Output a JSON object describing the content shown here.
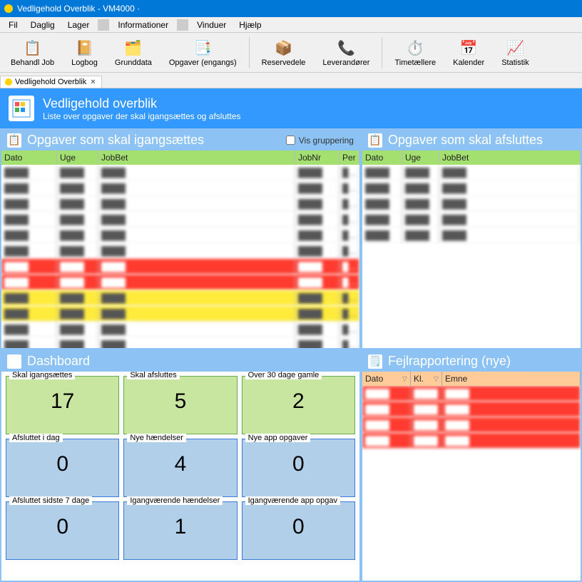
{
  "window": {
    "title": "Vedligehold Overblik - VM4000 ·"
  },
  "menu": [
    "Fil",
    "Daglig",
    "Lager",
    "Informationer",
    "Vinduer",
    "Hjælp"
  ],
  "toolbar": [
    {
      "icon": "📋",
      "label": "Behandl Job"
    },
    {
      "icon": "📔",
      "label": "Logbog"
    },
    {
      "icon": "🗂️",
      "label": "Grunddata"
    },
    {
      "icon": "📑",
      "label": "Opgaver (engangs)"
    },
    {
      "icon": "📦",
      "label": "Reservedele"
    },
    {
      "icon": "📞",
      "label": "Leverandører"
    },
    {
      "icon": "⏱️",
      "label": "Timetællere"
    },
    {
      "icon": "📅",
      "label": "Kalender"
    },
    {
      "icon": "📈",
      "label": "Statistik"
    }
  ],
  "tab": {
    "label": "Vedligehold Overblik"
  },
  "banner": {
    "title": "Vedligehold overblik",
    "subtitle": "Liste over opgaver der skal igangsættes og afsluttes"
  },
  "panel_start": {
    "title": "Opgaver som skal igangsættes",
    "checkbox": "Vis gruppering",
    "cols": [
      "Dato",
      "Uge",
      "JobBet",
      "JobNr",
      "Per"
    ],
    "rows": [
      {
        "cls": ""
      },
      {
        "cls": ""
      },
      {
        "cls": ""
      },
      {
        "cls": ""
      },
      {
        "cls": ""
      },
      {
        "cls": ""
      },
      {
        "cls": "red"
      },
      {
        "cls": "red"
      },
      {
        "cls": "yellow"
      },
      {
        "cls": "yellow"
      },
      {
        "cls": ""
      },
      {
        "cls": ""
      }
    ]
  },
  "panel_finish": {
    "title": "Opgaver som skal afsluttes",
    "cols": [
      "Dato",
      "Uge",
      "JobBet"
    ],
    "rows": [
      {},
      {},
      {},
      {},
      {}
    ]
  },
  "dashboard": {
    "title": "Dashboard",
    "cards": [
      {
        "label": "Skal igangsættes",
        "value": "17",
        "cls": "bgreen"
      },
      {
        "label": "Skal afsluttes",
        "value": "5",
        "cls": "bgreen"
      },
      {
        "label": "Over 30 dage gamle",
        "value": "2",
        "cls": "bgreen"
      },
      {
        "label": "Afsluttet i dag",
        "value": "0",
        "cls": "bblue"
      },
      {
        "label": "Nye hændelser",
        "value": "4",
        "cls": "bblue"
      },
      {
        "label": "Nye app opgaver",
        "value": "0",
        "cls": "bblue"
      },
      {
        "label": "Afsluttet sidste 7 dage",
        "value": "0",
        "cls": "bblue"
      },
      {
        "label": "Igangværende hændelser",
        "value": "1",
        "cls": "bblue"
      },
      {
        "label": "Igangværende app opgav",
        "value": "0",
        "cls": "bblue"
      }
    ]
  },
  "fejl": {
    "title": "Fejlrapportering (nye)",
    "cols": [
      "Dato",
      "Kl.",
      "Emne"
    ],
    "rows": [
      {
        "cls": "red"
      },
      {
        "cls": "red"
      },
      {
        "cls": "red"
      },
      {
        "cls": "red"
      }
    ]
  }
}
